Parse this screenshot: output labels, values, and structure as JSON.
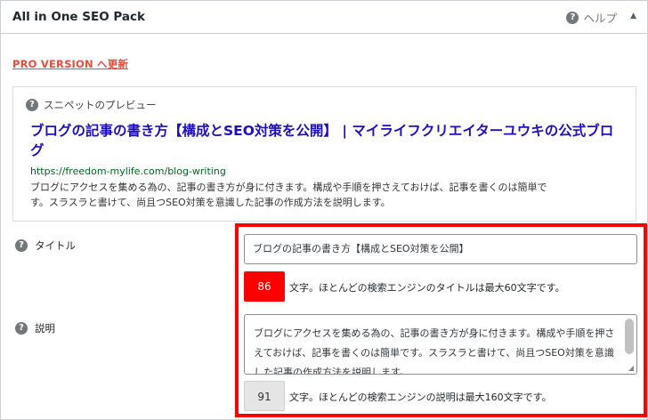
{
  "panel": {
    "title": "All in One SEO Pack",
    "help_label": "ヘルプ",
    "collapse_glyph": "▲"
  },
  "pro_link": "PRO VERSION へ更新",
  "preview": {
    "label": "スニペットのプレビュー",
    "title": "ブログの記事の書き方【構成とSEO対策を公開】 | マイライフクリエイターユウキの公式ブログ",
    "url": "https://freedom-mylife.com/blog-writing",
    "description": "ブログにアクセスを集める為の、記事の書き方が身に付きます。構成や手順を押さえておけば、記事を書くのは簡単です。スラスラと書けて、尚且つSEO対策を意識した記事の作成方法を説明します。"
  },
  "fields": {
    "title": {
      "label": "タイトル",
      "value": "ブログの記事の書き方【構成とSEO対策を公開】",
      "count": "86",
      "count_text": "文字。ほとんどの検索エンジンのタイトルは最大60文字です。"
    },
    "description": {
      "label": "説明",
      "value": "ブログにアクセスを集める為の、記事の書き方が身に付きます。構成や手順を押さえておけば、記事を書くのは簡単です。スラスラと書けて、尚且つSEO対策を意識した記事の作成方法を説明します。",
      "count": "91",
      "count_text": "文字。ほとんどの検索エンジンの説明は最大160文字です。"
    }
  },
  "icons": {
    "help": "question-circle-icon",
    "collapse": "triangle-up-icon"
  },
  "colors": {
    "pro_link": "#e74c3c",
    "snippet_title": "#1e0fbe",
    "snippet_url": "#006621",
    "highlight_box": "#ff0000",
    "title_count_bg": "#ff0000",
    "desc_count_bg": "#e5e5e5"
  }
}
